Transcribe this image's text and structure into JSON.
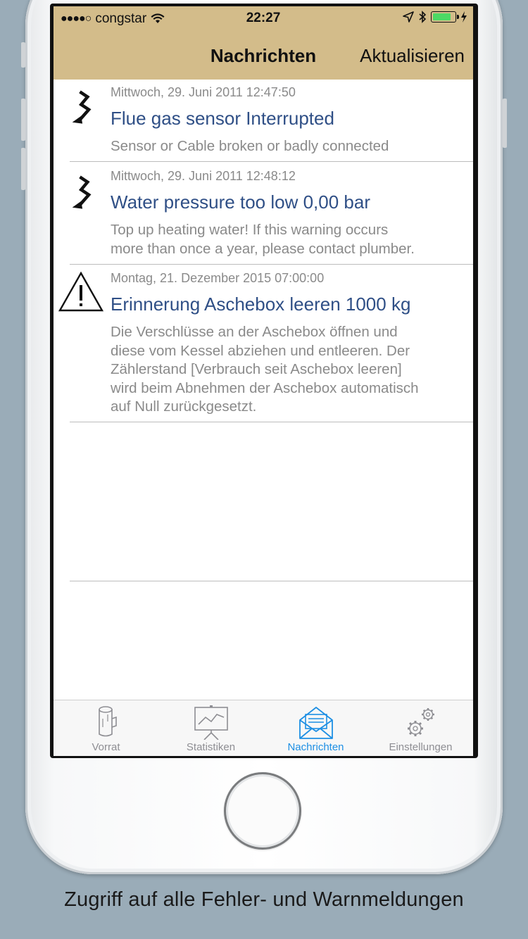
{
  "status_bar": {
    "signal": "●●●●○",
    "carrier": "congstar",
    "time": "22:27",
    "battery_level": 0.9
  },
  "nav": {
    "title": "Nachrichten",
    "action": "Aktualisieren"
  },
  "messages": [
    {
      "icon": "lightning-icon",
      "date": "Mittwoch, 29. Juni 2011 12:47:50",
      "title": "Flue gas sensor Interrupted",
      "body": [
        "Sensor or Cable broken or badly connected"
      ]
    },
    {
      "icon": "lightning-icon",
      "date": "Mittwoch, 29. Juni 2011 12:48:12",
      "title": "Water pressure too low 0,00 bar",
      "body": [
        "Top up heating water! If this warning occurs",
        "more than once a year, please contact plumber."
      ]
    },
    {
      "icon": "warning-triangle-icon",
      "date": "Montag, 21. Dezember 2015 07:00:00",
      "title": "Erinnerung Aschebox leeren 1000 kg",
      "body": [
        "Die Verschlüsse an der Aschebox öffnen und",
        "diese vom Kessel abziehen und entleeren. Der",
        "Zählerstand [Verbrauch seit Aschebox leeren]",
        "wird beim Abnehmen der Aschebox automatisch",
        "auf Null zurückgesetzt."
      ]
    }
  ],
  "tabs": [
    {
      "label": "Vorrat",
      "icon": "log-icon",
      "active": false
    },
    {
      "label": "Statistiken",
      "icon": "chart-easel-icon",
      "active": false
    },
    {
      "label": "Nachrichten",
      "icon": "envelope-icon",
      "active": true
    },
    {
      "label": "Einstellungen",
      "icon": "gears-icon",
      "active": false
    }
  ],
  "colors": {
    "nav_background": "#d3bc8a",
    "title_text": "#2f4f86",
    "tab_active": "#1d8fe4",
    "page_background": "#9aacb8"
  },
  "caption": "Zugriff auf alle Fehler- und Warnmeldungen"
}
